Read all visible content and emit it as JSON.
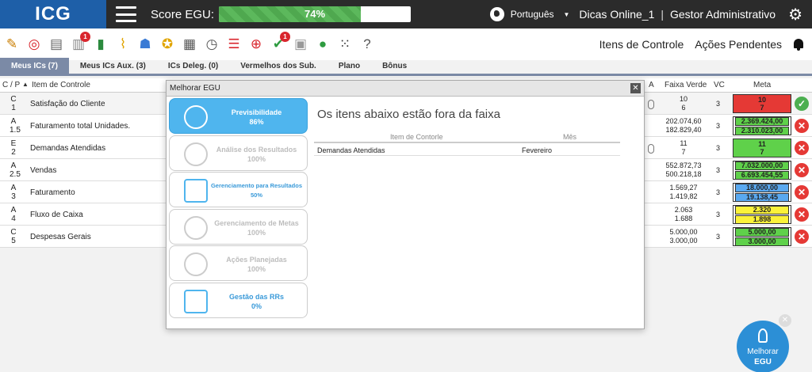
{
  "header": {
    "logo": "ICG",
    "score_label": "Score EGU:",
    "score_value": "74%",
    "score_fraction": 0.74,
    "language": "Português",
    "user": "Dicas Online_1",
    "separator": "|",
    "role": "Gestor Administrativo"
  },
  "toolbar": {
    "icons": [
      "edit-icon",
      "target-icon",
      "clipboard-icon",
      "document-alert-icon",
      "chart-down-icon",
      "paperclip-icon",
      "team-icon",
      "medal-icon",
      "calendar-icon",
      "stopwatch-icon",
      "hierarchy-icon",
      "crosshair-icon",
      "check-alert-icon",
      "pdf-icon",
      "green-dot-icon",
      "apps-grid-icon",
      "help-icon"
    ],
    "badges": {
      "document": "1",
      "check": "1"
    },
    "itens_controle": "Itens de Controle",
    "acoes_pendentes": "Ações Pendentes"
  },
  "tabs": [
    "Meus ICs (7)",
    "Meus ICs Aux. (3)",
    "ICs Deleg. (0)",
    "Vermelhos dos Sub.",
    "Plano",
    "Bônus"
  ],
  "table": {
    "col_cp": "C / P",
    "col_item": "Item de Controle",
    "col_a": "A",
    "col_fv": "Faixa Verde",
    "col_vc": "VC",
    "col_meta": "Meta",
    "rows": [
      {
        "c": "C",
        "p": "1",
        "name": "Satisfação do Cliente",
        "fv1": "10",
        "fv2": "6",
        "vc": "3",
        "meta1": "10",
        "meta2": "7",
        "status": "ok"
      },
      {
        "c": "A",
        "p": "1.5",
        "name": "Faturamento total Unidades.",
        "fv1": "202.074,60",
        "fv2": "182.829,40",
        "vc": "3",
        "meta1": "2.369.424,00",
        "meta2": "2.310.023,00",
        "status": "bad"
      },
      {
        "c": "E",
        "p": "2",
        "name": "Demandas Atendidas",
        "fv1": "11",
        "fv2": "7",
        "vc": "3",
        "meta1": "11",
        "meta2": "7",
        "status": "bad"
      },
      {
        "c": "A",
        "p": "2.5",
        "name": "Vendas",
        "fv1": "552.872,73",
        "fv2": "500.218,18",
        "vc": "3",
        "meta1": "7.032.000,00",
        "meta2": "6.693.454,55",
        "status": "bad"
      },
      {
        "c": "A",
        "p": "3",
        "name": "Faturamento",
        "fv1": "1.569,27",
        "fv2": "1.419,82",
        "vc": "3",
        "meta1": "18.000,00",
        "meta2": "19.138,45",
        "status": "bad"
      },
      {
        "c": "A",
        "p": "4",
        "name": "Fluxo de Caixa",
        "fv1": "2.063",
        "fv2": "1.688",
        "vc": "3",
        "meta1": "2.320",
        "meta2": "1.898",
        "status": "bad"
      },
      {
        "c": "C",
        "p": "5",
        "name": "Despesas Gerais",
        "fv1": "5.000,00",
        "fv2": "3.000,00",
        "vc": "3",
        "meta1": "5.000,00",
        "meta2": "3.000,00",
        "status": "bad"
      }
    ]
  },
  "colors": {
    "meta_red": "#e53935",
    "meta_green": "#5fd14a",
    "meta_blue": "#5aa9f0",
    "meta_yellow": "#fbf23a"
  },
  "modal": {
    "title": "Melhorar EGU",
    "heading": "Os itens abaixo estão fora da faixa",
    "col_item": "Item de Contorle",
    "col_mes": "Mês",
    "row_item": "Demandas Atendidas",
    "row_mes": "Fevereiro",
    "cards": [
      {
        "label": "Previsibilidade",
        "value": "86%"
      },
      {
        "label": "Análise dos Resultados",
        "value": "100%"
      },
      {
        "label": "Gerenciamento para Resultados",
        "value": "50%"
      },
      {
        "label": "Gerenciamento de Metas",
        "value": "100%"
      },
      {
        "label": "Ações Planejadas",
        "value": "100%"
      },
      {
        "label": "Gestão das RRs",
        "value": "0%"
      }
    ]
  },
  "fab": {
    "line1": "Melhorar",
    "line2": "EGU"
  }
}
